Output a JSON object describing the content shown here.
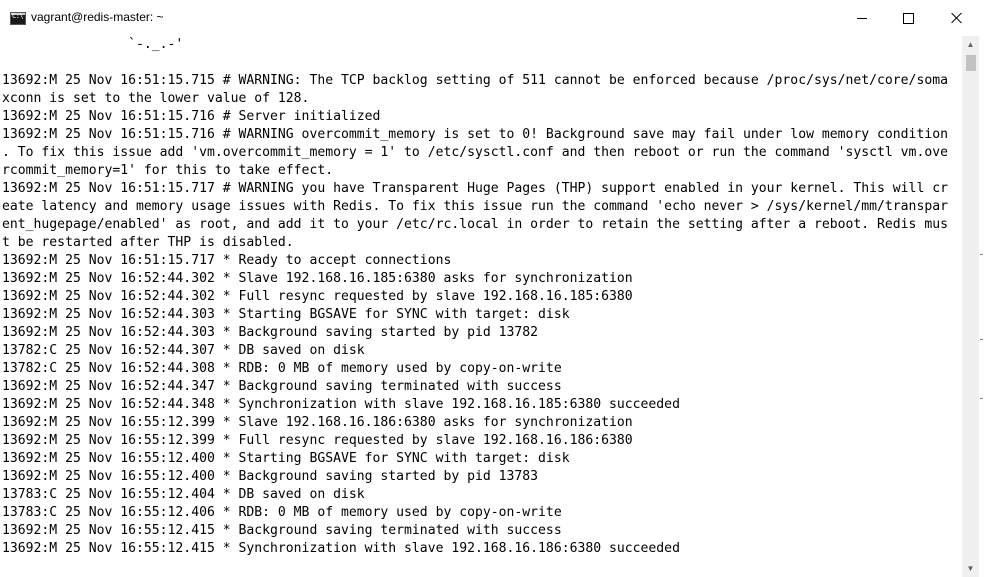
{
  "window": {
    "title": "vagrant@redis-master: ~",
    "icon": "console-icon",
    "icon_text": "C:\\"
  },
  "controls": {
    "minimize": "minimize-icon",
    "maximize": "maximize-icon",
    "close": "close-icon"
  },
  "scrollbar": {
    "up": "▲",
    "down": "▼"
  },
  "console": {
    "lines": [
      "                `-._.-'",
      "",
      "13692:M 25 Nov 16:51:15.715 # WARNING: The TCP backlog setting of 511 cannot be enforced because /proc/sys/net/core/soma",
      "xconn is set to the lower value of 128.",
      "13692:M 25 Nov 16:51:15.716 # Server initialized",
      "13692:M 25 Nov 16:51:15.716 # WARNING overcommit_memory is set to 0! Background save may fail under low memory condition",
      ". To fix this issue add 'vm.overcommit_memory = 1' to /etc/sysctl.conf and then reboot or run the command 'sysctl vm.ove",
      "rcommit_memory=1' for this to take effect.",
      "13692:M 25 Nov 16:51:15.717 # WARNING you have Transparent Huge Pages (THP) support enabled in your kernel. This will cr",
      "eate latency and memory usage issues with Redis. To fix this issue run the command 'echo never > /sys/kernel/mm/transpar",
      "ent_hugepage/enabled' as root, and add it to your /etc/rc.local in order to retain the setting after a reboot. Redis mus",
      "t be restarted after THP is disabled.",
      "13692:M 25 Nov 16:51:15.717 * Ready to accept connections",
      "13692:M 25 Nov 16:52:44.302 * Slave 192.168.16.185:6380 asks for synchronization",
      "13692:M 25 Nov 16:52:44.302 * Full resync requested by slave 192.168.16.185:6380",
      "13692:M 25 Nov 16:52:44.303 * Starting BGSAVE for SYNC with target: disk",
      "13692:M 25 Nov 16:52:44.303 * Background saving started by pid 13782",
      "13782:C 25 Nov 16:52:44.307 * DB saved on disk",
      "13782:C 25 Nov 16:52:44.308 * RDB: 0 MB of memory used by copy-on-write",
      "13692:M 25 Nov 16:52:44.347 * Background saving terminated with success",
      "13692:M 25 Nov 16:52:44.348 * Synchronization with slave 192.168.16.185:6380 succeeded",
      "13692:M 25 Nov 16:55:12.399 * Slave 192.168.16.186:6380 asks for synchronization",
      "13692:M 25 Nov 16:55:12.399 * Full resync requested by slave 192.168.16.186:6380",
      "13692:M 25 Nov 16:55:12.400 * Starting BGSAVE for SYNC with target: disk",
      "13692:M 25 Nov 16:55:12.400 * Background saving started by pid 13783",
      "13783:C 25 Nov 16:55:12.404 * DB saved on disk",
      "13783:C 25 Nov 16:55:12.406 * RDB: 0 MB of memory used by copy-on-write",
      "13692:M 25 Nov 16:55:12.415 * Background saving terminated with success",
      "13692:M 25 Nov 16:55:12.415 * Synchronization with slave 192.168.16.186:6380 succeeded"
    ]
  }
}
